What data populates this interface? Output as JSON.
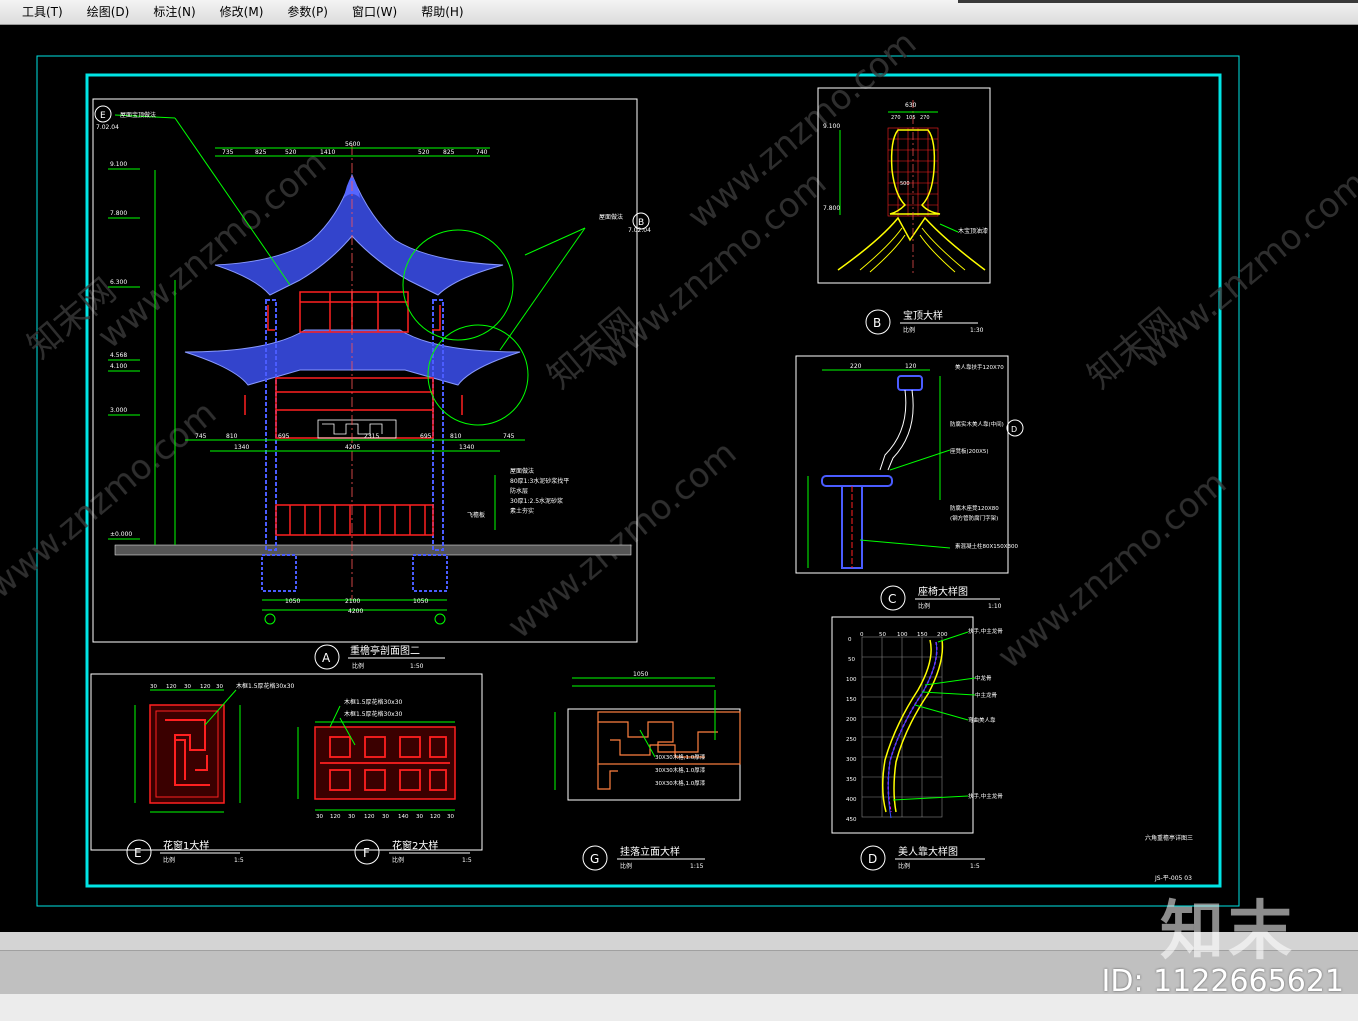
{
  "menu": {
    "items": [
      {
        "label": "工具(T)"
      },
      {
        "label": "绘图(D)"
      },
      {
        "label": "标注(N)"
      },
      {
        "label": "修改(M)"
      },
      {
        "label": "参数(P)"
      },
      {
        "label": "窗口(W)"
      },
      {
        "label": "帮助(H)"
      }
    ]
  },
  "drawing": {
    "colors": {
      "frame": "#00e5e5",
      "sheet": "#ffffff",
      "dim": "#00ff00",
      "roof": "#4a5cff",
      "red": "#ff2020",
      "yellow": "#ffff00"
    },
    "detail_a": {
      "marker": "A",
      "title": "重檐亭剖面图二",
      "scale_label": "比例",
      "scale": "1:50",
      "dims_top": [
        "735",
        "825",
        "520",
        "1410",
        "520",
        "825",
        "740"
      ],
      "dim_total": "5600",
      "dims_mid": [
        "745",
        "810",
        "695",
        "2315",
        "695",
        "810",
        "745"
      ],
      "dims_row2": [
        "1340",
        "4205",
        "1340"
      ],
      "dims_bottom": [
        "1050",
        "2100",
        "1050"
      ],
      "dim_bottom_total": "4200",
      "levels": [
        "9.100",
        "7.800",
        "6.300",
        "4.568",
        "4.100",
        "3.000",
        "±0.000"
      ],
      "callouts": [
        "屋面做法",
        "80厚1:3水泥砂浆找平",
        "防水层",
        "30厚1:2.5水泥砂浆",
        "素土夯实"
      ],
      "label_right": "飞檐板",
      "ref_tag": "E",
      "ref_sub": "7.02.04",
      "ref_tag2": "B",
      "ref_sub2": "7.02.04",
      "callout_e": "屋面宝顶做法",
      "callout_b": "屋面做法"
    },
    "detail_b": {
      "marker": "B",
      "title": "宝顶大样",
      "scale_label": "比例",
      "scale": "1:30",
      "levels": [
        "9.100",
        "7.800"
      ],
      "dims": [
        "270",
        "105",
        "270"
      ],
      "dim_total": "630",
      "label": "木宝顶油漆",
      "dim_mid": "500"
    },
    "detail_c": {
      "marker": "C",
      "title": "座椅大样图",
      "scale_label": "比例",
      "scale": "1:10",
      "dims": [
        "220",
        "120"
      ],
      "callouts": [
        "美人靠扶手120X70",
        "防腐实木美人靠(中间)",
        "座凳板(200X5)",
        "防腐木座凳120X80",
        "(钢方管防腐门字架)",
        "素混凝土柱80X150X300"
      ],
      "ref_tag": "D"
    },
    "detail_d": {
      "marker": "D",
      "title": "美人靠大样图",
      "scale_label": "比例",
      "scale": "1:5",
      "x_ticks": [
        "0",
        "50",
        "100",
        "150",
        "200"
      ],
      "y_ticks": [
        "0",
        "50",
        "100",
        "150",
        "200",
        "250",
        "300",
        "350",
        "400",
        "450"
      ],
      "callouts": [
        "扶手,中主龙骨",
        "中龙骨",
        "中主龙骨",
        "弯曲美人靠",
        "扶手,中主龙骨"
      ]
    },
    "detail_e": {
      "marker": "E",
      "title": "花窗1大样",
      "scale_label": "比例",
      "scale": "1:5",
      "callout": "木框1.5厚花格30x30",
      "dims": [
        "30",
        "120",
        "30",
        "120",
        "30"
      ]
    },
    "detail_f": {
      "marker": "F",
      "title": "花窗2大样",
      "scale_label": "比例",
      "scale": "1:5",
      "callouts": [
        "木框1.5厚花格30x30",
        "木框1.5厚花格30x30"
      ],
      "dims": [
        "30",
        "120",
        "30",
        "120",
        "30",
        "140",
        "30",
        "120",
        "30"
      ]
    },
    "detail_g": {
      "marker": "G",
      "title": "挂落立面大样",
      "scale_label": "比例",
      "scale": "1:15",
      "dim_total": "1050",
      "callouts": [
        "30X30木格,1.0厚漆",
        "30X30木格,1.0厚漆",
        "30X30木格,1.0厚漆"
      ]
    },
    "title_block": {
      "project": "六角重檐亭详图三",
      "sheet": "JS-平-005 03"
    },
    "watermark_text": "www.znzmo.com",
    "watermark_text2": "知末网"
  },
  "watermark": {
    "logo": "知末",
    "id": "ID: 1122665621"
  }
}
